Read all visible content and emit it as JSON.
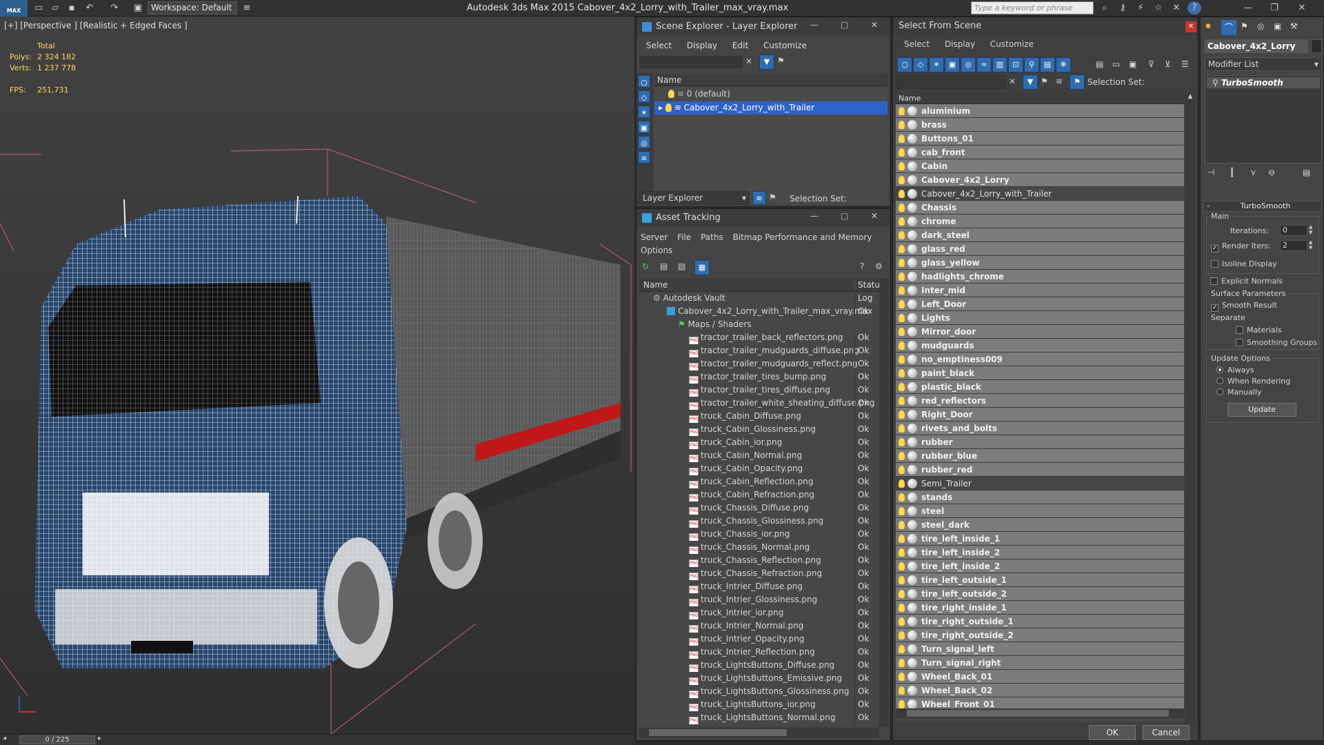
{
  "app": {
    "title": "Autodesk 3ds Max  2015    Cabover_4x2_Lorry_with_Trailer_max_vray.max",
    "workspace": "Workspace: Default",
    "search_placeholder": "Type a keyword or phrase",
    "logo": "MAX"
  },
  "viewport": {
    "label": "[+] [Perspective ] [Realistic + Edged Faces ]",
    "total_label": "Total",
    "polys_label": "Polys:",
    "polys_value": "2 324 182",
    "verts_label": "Verts:",
    "verts_value": "1 237 778",
    "fps_label": "FPS:",
    "fps_value": "251,731",
    "timeline": "0 / 225"
  },
  "scene_explorer": {
    "title": "Scene Explorer - Layer Explorer",
    "menu": [
      "Select",
      "Display",
      "Edit",
      "Customize"
    ],
    "column": "Name",
    "rows": [
      "0 (default)",
      "Cabover_4x2_Lorry_with_Trailer"
    ],
    "footer_label": "Layer Explorer",
    "selection_set": "Selection Set:"
  },
  "asset_tracking": {
    "title": "Asset Tracking",
    "menu": [
      "Server",
      "File",
      "Paths",
      "Bitmap Performance and Memory",
      "Options"
    ],
    "col_name": "Name",
    "col_status": "Statu",
    "vault": "Autodesk Vault",
    "vault_status": "Log",
    "file": "Cabover_4x2_Lorry_with_Trailer_max_vray.max",
    "file_status": "Ok",
    "maps": "Maps / Shaders",
    "status_ok": "Ok",
    "files": [
      "tractor_trailer_back_reflectors.png",
      "tractor_trailer_mudguards_diffuse.png",
      "tractor_trailer_mudguards_reflect.png",
      "tractor_trailer_tires_bump.png",
      "tractor_trailer_tires_diffuse.png",
      "tractor_trailer_white_sheating_diffuse.png",
      "truck_Cabin_Diffuse.png",
      "truck_Cabin_Glossiness.png",
      "truck_Cabin_ior.png",
      "truck_Cabin_Normal.png",
      "truck_Cabin_Opacity.png",
      "truck_Cabin_Reflection.png",
      "truck_Cabin_Refraction.png",
      "truck_Chassis_Diffuse.png",
      "truck_Chassis_Glossiness.png",
      "truck_Chassis_ior.png",
      "truck_Chassis_Normal.png",
      "truck_Chassis_Reflection.png",
      "truck_Chassis_Refraction.png",
      "truck_Intrier_Diffuse.png",
      "truck_Intrier_Glossiness.png",
      "truck_Intrier_ior.png",
      "truck_Intrier_Normal.png",
      "truck_Intrier_Opacity.png",
      "truck_Intrier_Reflection.png",
      "truck_LightsButtons_Diffuse.png",
      "truck_LightsButtons_Emissive.png",
      "truck_LightsButtons_Glossiness.png",
      "truck_LightsButtons_ior.png",
      "truck_LightsButtons_Normal.png"
    ]
  },
  "select_from_scene": {
    "title": "Select From Scene",
    "menu": [
      "Select",
      "Display",
      "Customize"
    ],
    "selection_set": "Selection Set:",
    "column": "Name",
    "items": [
      {
        "name": "aluminium",
        "selected": true
      },
      {
        "name": "brass",
        "selected": true
      },
      {
        "name": "Buttons_01",
        "selected": true
      },
      {
        "name": "cab_front",
        "selected": true
      },
      {
        "name": "Cabin",
        "selected": true
      },
      {
        "name": "Cabover_4x2_Lorry",
        "selected": true
      },
      {
        "name": "Cabover_4x2_Lorry_with_Trailer",
        "selected": false
      },
      {
        "name": "Chassis",
        "selected": true
      },
      {
        "name": "chrome",
        "selected": true
      },
      {
        "name": "dark_steel",
        "selected": true
      },
      {
        "name": "glass_red",
        "selected": true
      },
      {
        "name": "glass_yellow",
        "selected": true
      },
      {
        "name": "hadlights_chrome",
        "selected": true
      },
      {
        "name": "Inter_mid",
        "selected": true
      },
      {
        "name": "Left_Door",
        "selected": true
      },
      {
        "name": "Lights",
        "selected": true
      },
      {
        "name": "Mirror_door",
        "selected": true
      },
      {
        "name": "mudguards",
        "selected": true
      },
      {
        "name": "no_emptiness009",
        "selected": true
      },
      {
        "name": "paint_black",
        "selected": true
      },
      {
        "name": "plastic_black",
        "selected": true
      },
      {
        "name": "red_reflectors",
        "selected": true
      },
      {
        "name": "Right_Door",
        "selected": true
      },
      {
        "name": "rivets_and_bolts",
        "selected": true
      },
      {
        "name": "rubber",
        "selected": true
      },
      {
        "name": "rubber_blue",
        "selected": true
      },
      {
        "name": "rubber_red",
        "selected": true
      },
      {
        "name": "Semi_Trailer",
        "selected": false
      },
      {
        "name": "stands",
        "selected": true
      },
      {
        "name": "steel",
        "selected": true
      },
      {
        "name": "steel_dark",
        "selected": true
      },
      {
        "name": "tire_left_inside_1",
        "selected": true
      },
      {
        "name": "tire_left_inside_2",
        "selected": true
      },
      {
        "name": "tire_left_inside_2",
        "selected": true
      },
      {
        "name": "tire_left_outside_1",
        "selected": true
      },
      {
        "name": "tire_left_outside_2",
        "selected": true
      },
      {
        "name": "tire_right_inside_1",
        "selected": true
      },
      {
        "name": "tire_right_outside_1",
        "selected": true
      },
      {
        "name": "tire_right_outside_2",
        "selected": true
      },
      {
        "name": "Turn_signal_left",
        "selected": true
      },
      {
        "name": "Turn_signal_right",
        "selected": true
      },
      {
        "name": "Wheel_Back_01",
        "selected": true
      },
      {
        "name": "Wheel_Back_02",
        "selected": true
      },
      {
        "name": "Wheel_Front_01",
        "selected": true
      }
    ],
    "ok": "OK",
    "cancel": "Cancel"
  },
  "command_panel": {
    "object_name": "Cabover_4x2_Lorry",
    "modifier_list": "Modifier List",
    "stack_item": "TurboSmooth",
    "rollout_title": "TurboSmooth",
    "main": "Main",
    "iterations_label": "Iterations:",
    "iterations_value": "0",
    "render_iters_label": "Render Iters:",
    "render_iters_value": "2",
    "isoline": "Isoline Display",
    "explicit": "Explicit Normals",
    "surface": "Surface Parameters",
    "smooth": "Smooth Result",
    "separate": "Separate",
    "materials": "Materials",
    "smoothing_groups": "Smoothing Groups",
    "update_options": "Update Options",
    "always": "Always",
    "when_rendering": "When Rendering",
    "manually": "Manually",
    "update": "Update"
  },
  "colors": {
    "selection_blue": "#2e62c8",
    "selected_row": "#7c7c7c",
    "stat_yellow": "#ffd860"
  }
}
